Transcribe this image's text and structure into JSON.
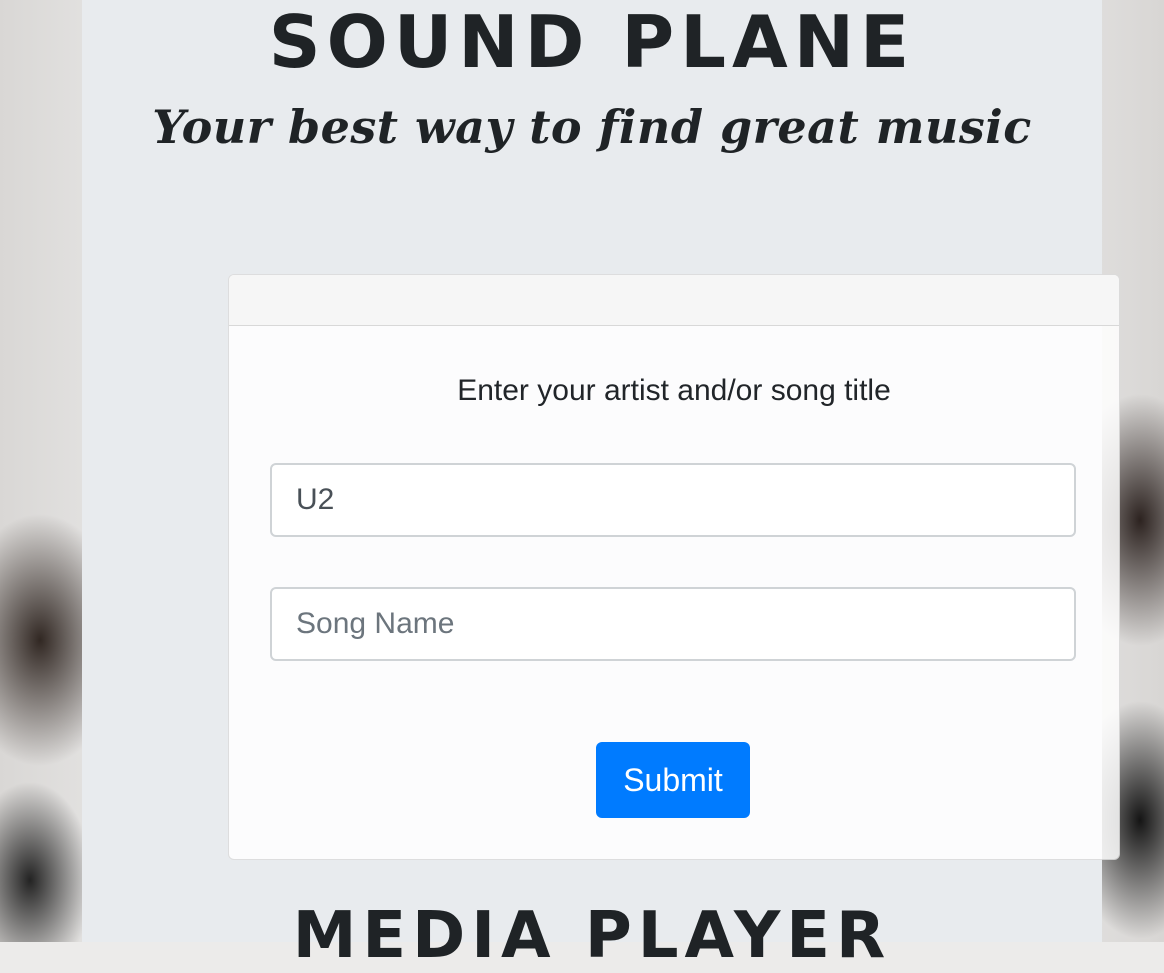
{
  "header": {
    "title": "Sound Plane",
    "subtitle": "Your best way to find great music"
  },
  "search_card": {
    "instruction": "Enter your artist and/or song title",
    "artist_input_value": "U2",
    "song_input_placeholder": "Song Name",
    "submit_label": "Submit"
  },
  "sections": {
    "media_player_title": "Media Player"
  },
  "colors": {
    "accent": "#007bff",
    "container_bg": "#e8ebee"
  }
}
